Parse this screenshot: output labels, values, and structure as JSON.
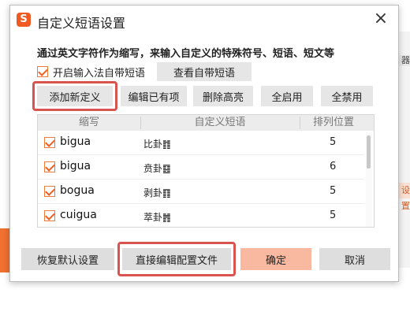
{
  "background": {
    "right_chip_1": "器",
    "right_chip_2": "设置"
  },
  "dialog": {
    "logo_text": "S",
    "title": "自定义短语设置",
    "close_symbol": "×",
    "description": "通过英文字符作为缩写，来输入自定义的特殊符号、短语、短文等",
    "enable_builtin_label": "开启输入法自带短语",
    "enable_builtin_checked": true,
    "view_builtin_label": "查看自带短语",
    "toolbar": {
      "add": "添加新定义",
      "edit": "编辑已有项",
      "delete_highlight": "删除高亮",
      "enable_all": "全启用",
      "disable_all": "全禁用"
    },
    "table": {
      "headers": {
        "abbr": "缩写",
        "phrase": "自定义短语",
        "position": "排列位置"
      },
      "rows": [
        {
          "checked": true,
          "abbr": "bigua",
          "phrase": "比卦䷇",
          "position": "5"
        },
        {
          "checked": true,
          "abbr": "bigua",
          "phrase": "贲卦䷕",
          "position": "6"
        },
        {
          "checked": true,
          "abbr": "bogua",
          "phrase": "剥卦䷖",
          "position": "5"
        },
        {
          "checked": true,
          "abbr": "cuigua",
          "phrase": "萃卦䷬",
          "position": "5"
        }
      ]
    },
    "footer": {
      "restore_default": "恢复默认设置",
      "edit_config": "直接编辑配置文件",
      "ok": "确定",
      "cancel": "取消"
    }
  },
  "colors": {
    "accent": "#f05a22",
    "highlight_box": "#d9534f",
    "ok_button": "#f9b9a0"
  }
}
